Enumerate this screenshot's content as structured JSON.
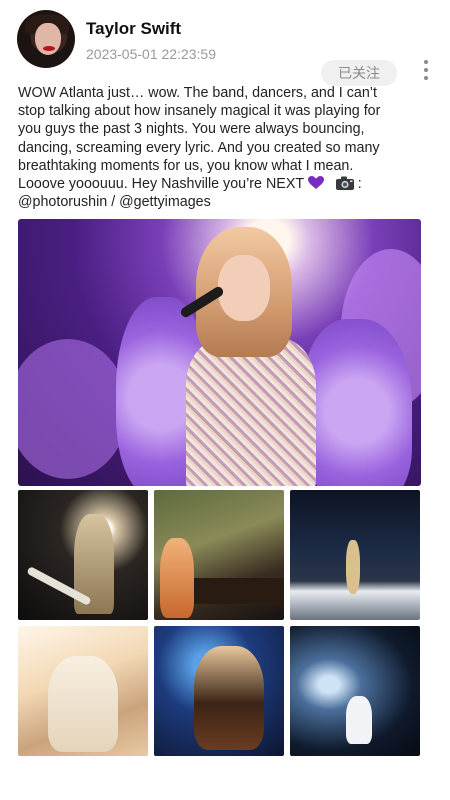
{
  "post": {
    "user_name": "Taylor Swift",
    "timestamp": "2023-05-01 22:23:59",
    "follow_label": "已关注",
    "text_lines": [
      "WOW Atlanta just… wow. The band, dancers, and I can’t",
      "stop talking about how insanely magical it was playing for",
      "you guys the past 3 nights. You were always bouncing,",
      "dancing, screaming every lyric. And you created so many",
      "breathtaking moments for us, you know what I mean.",
      "Looove yooouuu. Hey Nashville you’re NEXT",
      ":",
      "@photorushin / @gettyimages"
    ]
  },
  "icons": {
    "avatar": "avatar",
    "more": "more-vertical-icon",
    "heart": "purple-heart-emoji-icon",
    "camera": "camera-emoji-icon"
  },
  "colors": {
    "heart": "#7b2cbf",
    "follow_bg": "#f0f0f0",
    "follow_text": "#8a8a8a",
    "timestamp": "#9a9a9a"
  },
  "images": [
    {
      "name": "hero-photo",
      "description": "Performer in purple fur coat singing into microphone"
    },
    {
      "name": "photo-guitar",
      "description": "Performer with guitar under spotlight"
    },
    {
      "name": "photo-piano",
      "description": "Performer at piano on mossy stage"
    },
    {
      "name": "photo-stage",
      "description": "Performer on stage in stadium"
    },
    {
      "name": "photo-white-dress",
      "description": "Performer in white flowing dress"
    },
    {
      "name": "photo-hair",
      "description": "Performer with flying hair under blue light"
    },
    {
      "name": "photo-spotlight",
      "description": "Performer in white gown in spotlight"
    }
  ]
}
